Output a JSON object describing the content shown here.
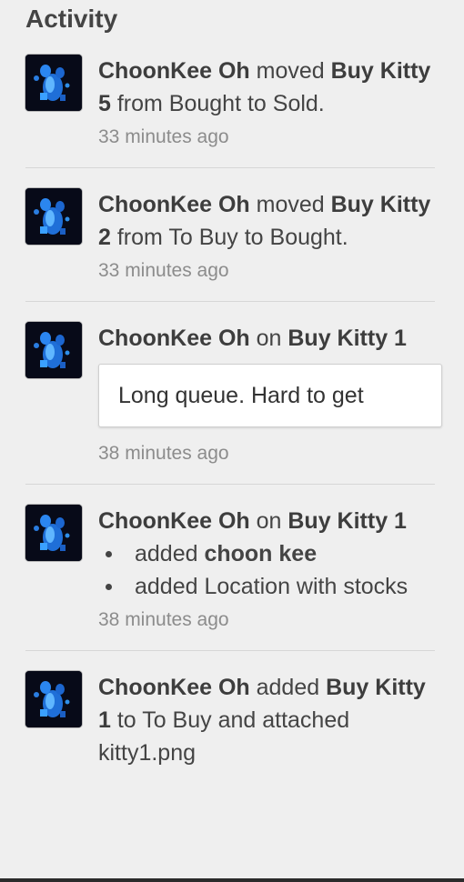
{
  "panel": {
    "title": "Activity"
  },
  "colors": {
    "background": "#efefef",
    "text": "#444444",
    "muted": "#8c8c8c",
    "divider": "#d6d6d6",
    "avatar_blue": "#2f8fe8"
  },
  "avatar_icon": "blue-creature-avatar-icon",
  "activities": [
    {
      "user": "ChoonKee Oh",
      "verb": " moved ",
      "card": "Buy Kitty 5",
      "rest": " from Bought to Sold.",
      "time": "33 minutes ago"
    },
    {
      "user": "ChoonKee Oh",
      "verb": " moved ",
      "card": "Buy Kitty 2",
      "rest": " from To Buy to Bought.",
      "time": "33 minutes ago"
    },
    {
      "user": "ChoonKee Oh",
      "verb": " on ",
      "card": "Buy Kitty 1",
      "comment": "Long queue. Hard to get",
      "time": "38 minutes ago"
    },
    {
      "user": "ChoonKee Oh",
      "verb": " on ",
      "card": "Buy Kitty 1",
      "change1_prefix": "added ",
      "change1_value": "choon kee",
      "change2_text": "added Location with stocks",
      "time": "38 minutes ago"
    },
    {
      "user": "ChoonKee Oh",
      "verb": " added ",
      "card": "Buy Kitty 1",
      "rest": " to To Buy and attached kitty1.png"
    }
  ]
}
